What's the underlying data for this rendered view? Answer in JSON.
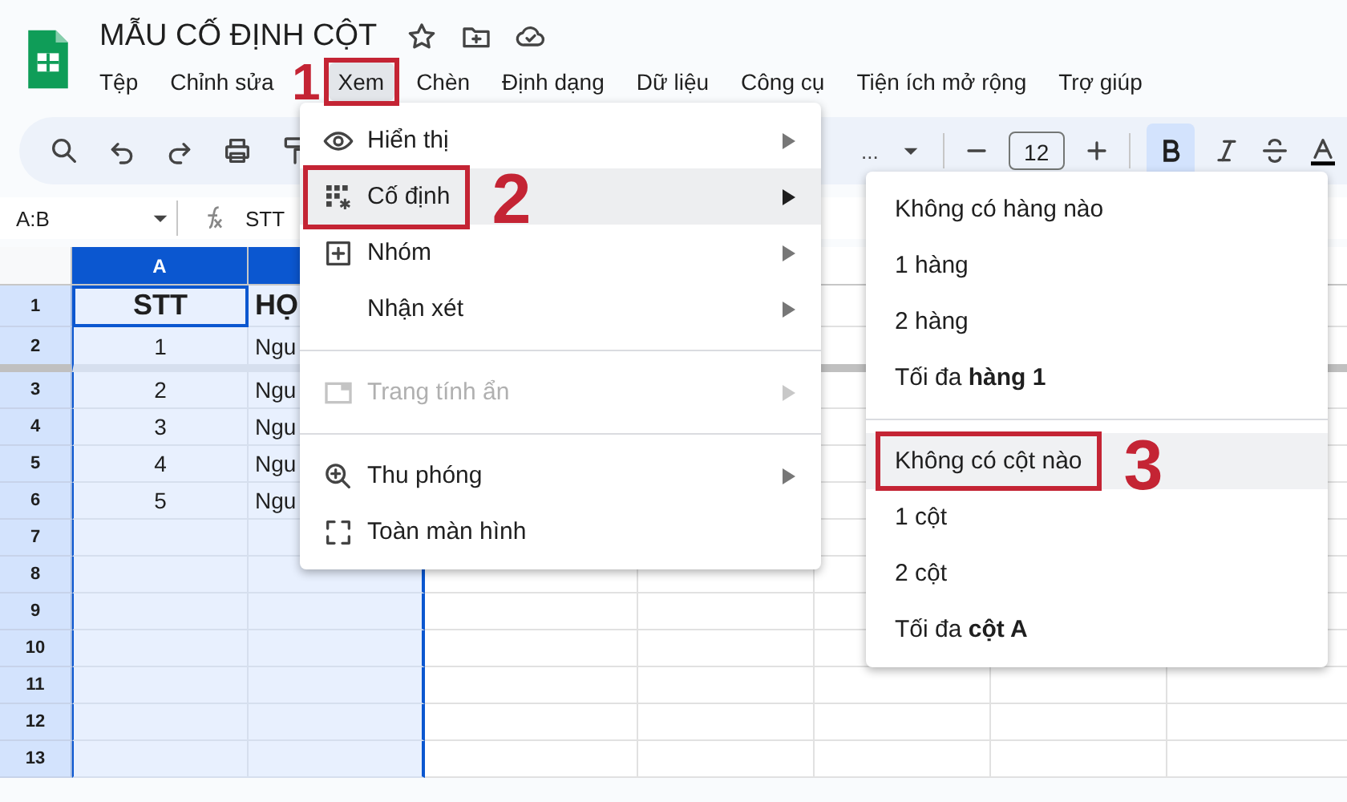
{
  "document": {
    "title": "MẪU CỐ ĐỊNH CỘT"
  },
  "menu_bar": [
    {
      "label": "Tệp",
      "selected": false
    },
    {
      "label": "Chỉnh sửa",
      "selected": false
    },
    {
      "label": "Xem",
      "selected": true,
      "callout": "1"
    },
    {
      "label": "Chèn",
      "selected": false
    },
    {
      "label": "Định dạng",
      "selected": false
    },
    {
      "label": "Dữ liệu",
      "selected": false
    },
    {
      "label": "Công cụ",
      "selected": false
    },
    {
      "label": "Tiện ích mở rộng",
      "selected": false
    },
    {
      "label": "Trợ giúp",
      "selected": false
    }
  ],
  "toolbar": {
    "font_field": "...",
    "font_size": "12",
    "bold": true
  },
  "formula_bar": {
    "name_box": "A:B",
    "formula": "STT"
  },
  "sheet": {
    "columns": [
      {
        "label": "A",
        "selected": true
      },
      {
        "selected": true
      }
    ],
    "rows": [
      {
        "number": "1",
        "header": true,
        "frozen_boundary": false,
        "cells": [
          "STT",
          "HỌ"
        ]
      },
      {
        "number": "2",
        "header": false,
        "frozen_boundary": true,
        "cells": [
          "1",
          "Ngu"
        ]
      },
      {
        "number": "3",
        "header": false,
        "frozen_boundary": false,
        "cells": [
          "2",
          "Ngu"
        ]
      },
      {
        "number": "4",
        "header": false,
        "frozen_boundary": false,
        "cells": [
          "3",
          "Ngu"
        ]
      },
      {
        "number": "5",
        "header": false,
        "frozen_boundary": false,
        "cells": [
          "4",
          "Ngu"
        ]
      },
      {
        "number": "6",
        "header": false,
        "frozen_boundary": false,
        "cells": [
          "5",
          "Ngu"
        ]
      },
      {
        "number": "7",
        "header": false,
        "frozen_boundary": false,
        "cells": []
      },
      {
        "number": "8",
        "header": false,
        "frozen_boundary": false,
        "cells": []
      },
      {
        "number": "9",
        "header": false,
        "frozen_boundary": false,
        "cells": []
      },
      {
        "number": "10",
        "header": false,
        "frozen_boundary": false,
        "cells": []
      },
      {
        "number": "11",
        "header": false,
        "frozen_boundary": false,
        "cells": []
      },
      {
        "number": "12",
        "header": false,
        "frozen_boundary": false,
        "cells": []
      },
      {
        "number": "13",
        "header": false,
        "frozen_boundary": false,
        "cells": []
      }
    ]
  },
  "view_menu": {
    "items": [
      {
        "kind": "item",
        "label": "Hiển thị",
        "disabled": false,
        "selected": false
      },
      {
        "kind": "item",
        "label": "Cố định",
        "disabled": false,
        "selected": true,
        "callout": "2"
      },
      {
        "kind": "item",
        "label": "Nhóm",
        "disabled": false,
        "selected": false
      },
      {
        "kind": "item",
        "label": "Nhận xét",
        "disabled": false,
        "selected": false
      },
      {
        "kind": "divider"
      },
      {
        "kind": "item",
        "label": "Trang tính ẩn",
        "disabled": true,
        "selected": false
      },
      {
        "kind": "divider"
      },
      {
        "kind": "item",
        "label": "Thu phóng",
        "disabled": false,
        "selected": false
      },
      {
        "kind": "plain",
        "label": "Toàn màn hình",
        "disabled": false,
        "selected": false
      }
    ]
  },
  "freeze_submenu": {
    "items": [
      {
        "kind": "item",
        "label": "Không có hàng nào",
        "selected": false
      },
      {
        "kind": "item",
        "label": "1 hàng",
        "selected": false
      },
      {
        "kind": "item",
        "label": "2 hàng",
        "selected": false
      },
      {
        "kind": "item",
        "label": "Tối đa **hàng 1**",
        "selected": false
      },
      {
        "kind": "divider"
      },
      {
        "kind": "item",
        "label": "Không có cột nào",
        "selected": true,
        "callout": "3"
      },
      {
        "kind": "item",
        "label": "1 cột",
        "selected": false
      },
      {
        "kind": "item",
        "label": "2 cột",
        "selected": false
      },
      {
        "kind": "item",
        "label": "Tối đa **cột A**",
        "selected": false
      }
    ]
  }
}
